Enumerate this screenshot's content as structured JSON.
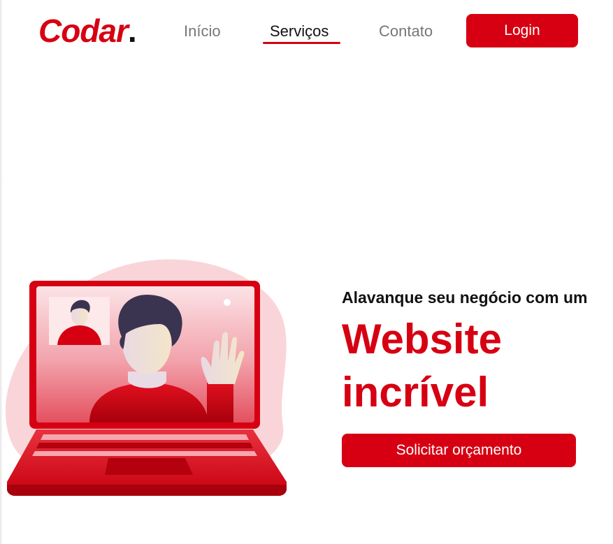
{
  "header": {
    "logo_text": "Codar",
    "logo_dot": ".",
    "nav": [
      {
        "label": "Início",
        "active": false
      },
      {
        "label": "Serviços",
        "active": true
      },
      {
        "label": "Contato",
        "active": false
      }
    ],
    "login_label": "Login"
  },
  "hero": {
    "subtitle": "Alavanque seu negócio com um",
    "headline_line1": "Website",
    "headline_line2": "incrível",
    "cta_label": "Solicitar orçamento",
    "illustration": "laptop-video-call-illustration"
  },
  "colors": {
    "brand_red": "#d60012",
    "nav_inactive": "#777777",
    "text_dark": "#111111",
    "blob_pink": "#f9d5d9"
  }
}
